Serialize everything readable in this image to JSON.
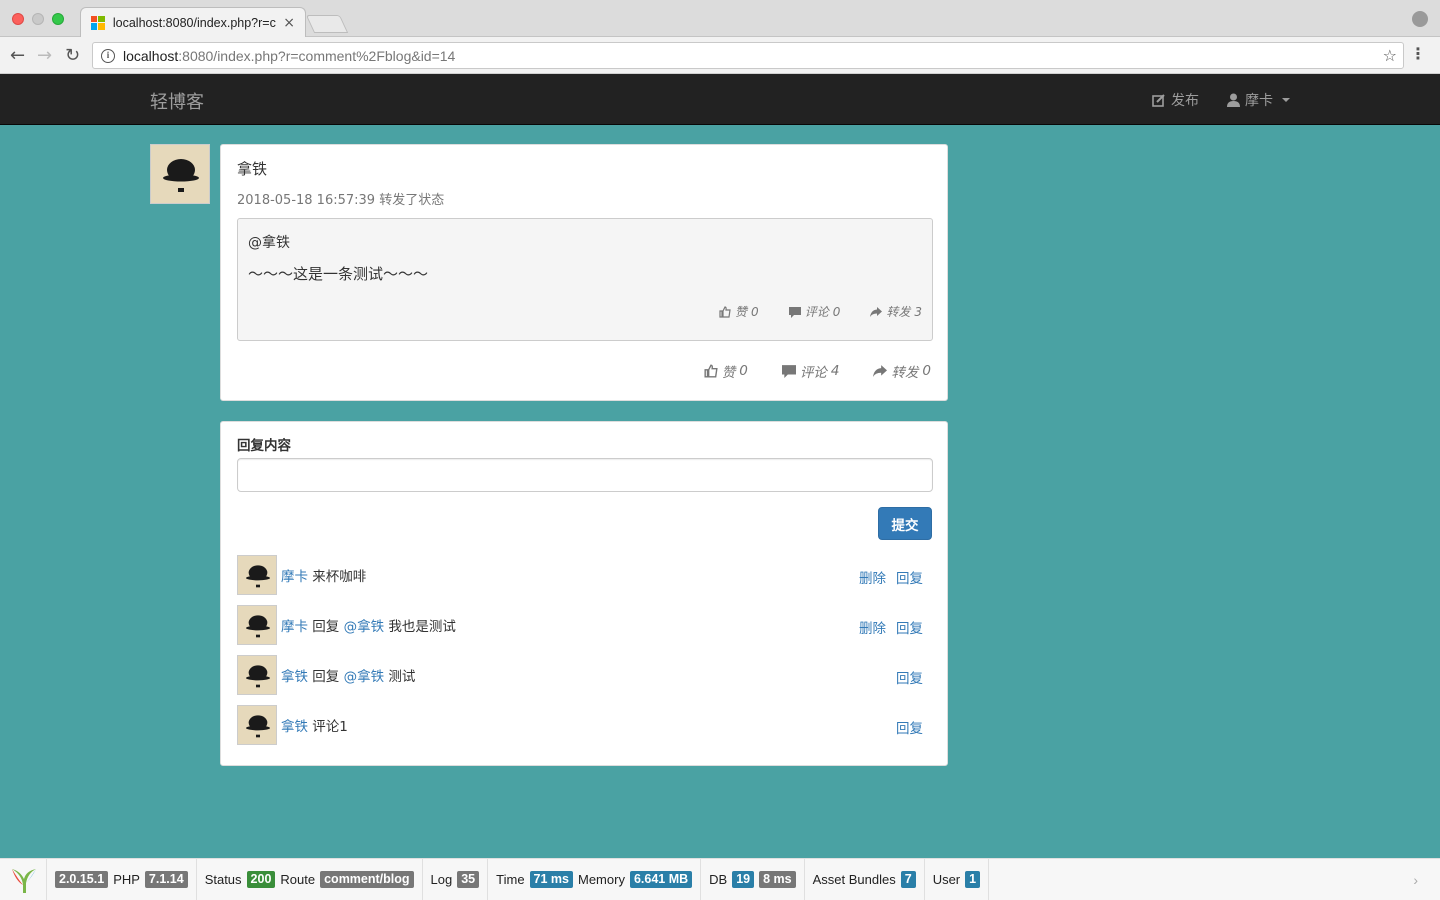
{
  "browser": {
    "tab_title": "localhost:8080/index.php?r=c",
    "tab_close": "×",
    "url_host": "localhost",
    "url_rest": ":8080/index.php?r=comment%2Fblog&id=14",
    "info_glyph": "i",
    "star_glyph": "☆",
    "menu_glyph": "⋮",
    "back_glyph": "←",
    "forward_glyph": "→",
    "reload_glyph": "↻"
  },
  "navbar": {
    "brand": "轻博客",
    "publish_label": "发布",
    "user_label": "摩卡"
  },
  "post": {
    "author": "拿铁",
    "meta": "2018-05-18 16:57:39 转发了状态",
    "quote": {
      "author": "@拿铁",
      "body": "～～～这是一条测试～～～",
      "like_label": "赞",
      "like_count": "0",
      "comment_label": "评论",
      "comment_count": "0",
      "share_label": "转发",
      "share_count": "3"
    },
    "like_label": "赞",
    "like_count": "0",
    "comment_label": "评论",
    "comment_count": "4",
    "share_label": "转发",
    "share_count": "0"
  },
  "reply": {
    "label": "回复内容",
    "input_value": "",
    "submit_label": "提交"
  },
  "comments": [
    {
      "user": "摩卡",
      "reply_word": "",
      "target": "",
      "text": "来杯咖啡",
      "delete_label": "删除",
      "reply_label": "回复"
    },
    {
      "user": "摩卡",
      "reply_word": "回复",
      "target": "@拿铁",
      "text": "我也是测试",
      "delete_label": "删除",
      "reply_label": "回复"
    },
    {
      "user": "拿铁",
      "reply_word": "回复",
      "target": "@拿铁",
      "text": "测试",
      "delete_label": "",
      "reply_label": "回复"
    },
    {
      "user": "拿铁",
      "reply_word": "",
      "target": "",
      "text": "评论1",
      "delete_label": "",
      "reply_label": "回复"
    }
  ],
  "debug": {
    "yii_version": "2.0.15.1",
    "php_label": "PHP",
    "php_version": "7.1.14",
    "status_label": "Status",
    "status_value": "200",
    "route_label": "Route",
    "route_value": "comment/blog",
    "log_label": "Log",
    "log_value": "35",
    "time_label": "Time",
    "time_value": "71 ms",
    "memory_label": "Memory",
    "memory_value": "6.641 MB",
    "db_label": "DB",
    "db_queries": "19",
    "db_time": "8 ms",
    "assets_label": "Asset Bundles",
    "assets_value": "7",
    "user_label": "User",
    "user_value": "1",
    "arrow": "›"
  },
  "colors": {
    "page_bg": "#4aa2a3",
    "navbar_bg": "#222222",
    "link": "#337ab7",
    "primary_button": "#337ab7"
  }
}
